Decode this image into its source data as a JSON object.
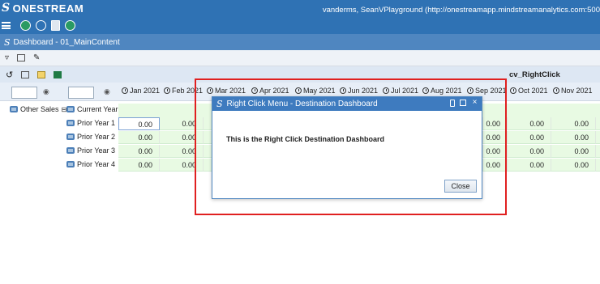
{
  "app": {
    "brand": "ONESTREAM",
    "user_info": "vanderms, SeanVPlayground (http://onestreamapp.mindstreamanalytics.com:500"
  },
  "tab": {
    "title": "Dashboard - 01_MainContent"
  },
  "cube_view": {
    "name": "cv_RightClick"
  },
  "grid": {
    "row_header": {
      "entity": "Other Sales",
      "scenario": "Current Year"
    },
    "columns": [
      "Jan 2021",
      "Feb 2021",
      "Mar 2021",
      "Apr 2021",
      "May 2021",
      "Jun 2021",
      "Jul 2021",
      "Aug 2021",
      "Sep 2021",
      "Oct 2021",
      "Nov 2021"
    ],
    "rows": [
      {
        "label": "Prior Year 1",
        "values": [
          "0.00",
          "0.00",
          "",
          "",
          "",
          "",
          "",
          "",
          "0.00",
          "0.00",
          "0.00"
        ]
      },
      {
        "label": "Prior Year 2",
        "values": [
          "0.00",
          "0.00",
          "",
          "",
          "",
          "",
          "",
          "",
          "0.00",
          "0.00",
          "0.00"
        ]
      },
      {
        "label": "Prior Year 3",
        "values": [
          "0.00",
          "0.00",
          "",
          "",
          "",
          "",
          "",
          "",
          "0.00",
          "0.00",
          "0.00"
        ]
      },
      {
        "label": "Prior Year 4",
        "values": [
          "0.00",
          "0.00",
          "",
          "",
          "",
          "",
          "",
          "",
          "0.00",
          "0.00",
          "0.00"
        ]
      }
    ]
  },
  "dialog": {
    "title": "Right Click Menu - Destination Dashboard",
    "message": "This is the Right Click Destination Dashboard",
    "close_label": "Close",
    "x_label": "×"
  },
  "colors": {
    "top_bar": "#2f72b4",
    "tab_bar": "#4f86c0",
    "cell_fill": "#e8fae3",
    "highlight": "#e02020"
  }
}
